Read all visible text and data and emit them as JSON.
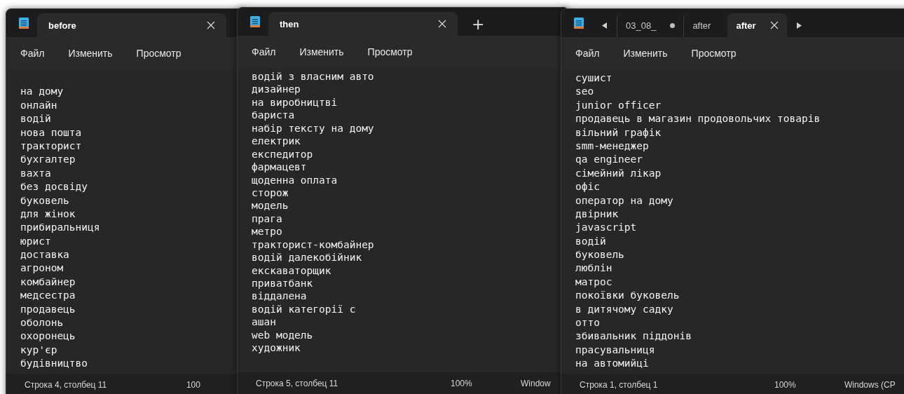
{
  "windows": [
    {
      "tabs": [
        {
          "label": "before",
          "selected": true,
          "modified": false
        }
      ],
      "menu": [
        "Файл",
        "Изменить",
        "Просмотр"
      ],
      "starts_with_blank_line": true,
      "lines": [
        "на дому",
        "онлайн",
        "водій",
        "нова пошта",
        "тракторист",
        "бухгалтер",
        "вахта",
        "без досвіду",
        "буковель",
        "для жінок",
        "прибиральниця",
        "юрист",
        "доставка",
        "агроном",
        "комбайнер",
        "медсестра",
        "продавець",
        "оболонь",
        "охоронець",
        "кур'єр",
        "будівництво"
      ],
      "status": {
        "position": "Строка 4, столбец 11",
        "zoom": "100"
      }
    },
    {
      "tabs": [
        {
          "label": "then",
          "selected": true,
          "modified": false
        }
      ],
      "new_tab": "+",
      "menu": [
        "Файл",
        "Изменить",
        "Просмотр"
      ],
      "lines": [
        "водій з власним авто",
        "дизайнер",
        "на виробництві",
        "бариста",
        "набір тексту на дому",
        "електрик",
        "експедитор",
        "фармацевт",
        "щоденна оплата",
        "сторож",
        "модель",
        "прага",
        "метро",
        "тракторист-комбайнер",
        "водій далекобійник",
        "екскаваторщик",
        "приватбанк",
        "віддалена",
        "водій категорії с",
        "ашан",
        "web модель",
        "художник"
      ],
      "status": {
        "position": "Строка 5, столбец 11",
        "zoom": "100%",
        "encoding": "Window"
      }
    },
    {
      "tab_arrows": true,
      "tabs": [
        {
          "label": "03_08_",
          "selected": false,
          "modified": true
        },
        {
          "label": "after",
          "selected": false,
          "modified": false
        },
        {
          "label": "after",
          "selected": true,
          "modified": false
        }
      ],
      "menu": [
        "Файл",
        "Изменить",
        "Просмотр"
      ],
      "lines": [
        "сушист",
        "seo",
        "junior officer",
        "продавець в магазин продовольчих товарів",
        "вільний графік",
        "smm-менеджер",
        "qa engineer",
        "сімейний лікар",
        "офіс",
        "оператор на дому",
        "двірник",
        "javascript",
        "водій",
        "буковель",
        "люблін",
        "матрос",
        "покоївки буковель",
        "в дитячому садку",
        "отто",
        "збивальник піддонів",
        "прасувальниця",
        "на автомийці"
      ],
      "status": {
        "position": "Строка 1, столбец 1",
        "zoom": "100%",
        "encoding": "Windows (CP"
      }
    }
  ]
}
